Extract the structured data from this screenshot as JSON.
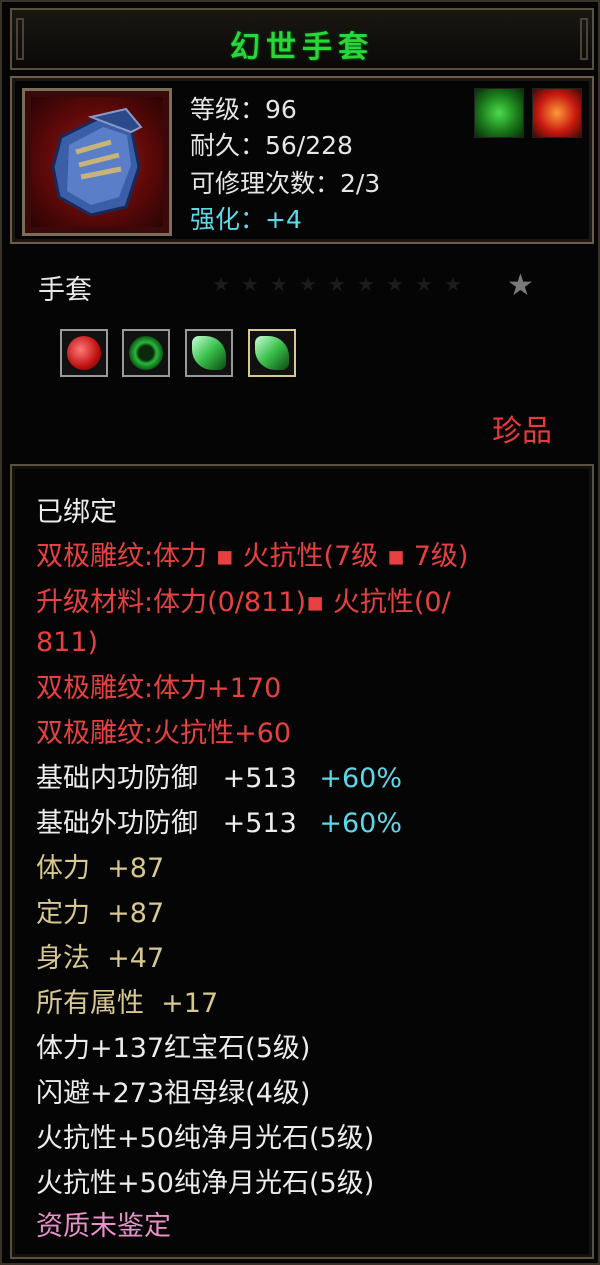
{
  "item": {
    "name": "幻世手套",
    "stats": {
      "level": "等级：96",
      "durability": "耐久：56/228",
      "repair_count": "可修理次数：2/3",
      "enhance": "强化：+4"
    },
    "type": "手套",
    "star_level": 0,
    "max_stars": 10,
    "rarity": "珍品",
    "icon": "blue-gauntlet-icon",
    "badges": [
      "green-rune-badge-icon",
      "red-rune-badge-icon"
    ],
    "gems": [
      {
        "icon": "ruby-gem-icon",
        "color": "#d01818"
      },
      {
        "icon": "emerald-ring-gem-icon",
        "color": "#2aa83a"
      },
      {
        "icon": "moonstone-gem-icon",
        "color": "#3ac04a"
      },
      {
        "icon": "moonstone-gem-icon",
        "color": "#3ac04a"
      }
    ]
  },
  "attributes": {
    "bound": "已绑定",
    "engrave_line": "双极雕纹:体力 ▪ 火抗性(7级 ▪ 7级)",
    "upgrade_line1": "升级材料:体力(0/811)▪ 火抗性(0/",
    "upgrade_line2": "811)",
    "engrave_vit": "双极雕纹:体力+170",
    "engrave_fire": "双极雕纹:火抗性+60",
    "inner_def_label": "基础内功防御",
    "inner_def_value": "+513",
    "inner_def_pct": "+60%",
    "outer_def_label": "基础外功防御",
    "outer_def_value": "+513",
    "outer_def_pct": "+60%",
    "vit": "体力  +87",
    "focus": "定力  +87",
    "agility": "身法  +47",
    "all_attr": "所有属性  +17",
    "gem1": "体力+137红宝石(5级)",
    "gem2": "闪避+273祖母绿(4级)",
    "gem3": "火抗性+50纯净月光石(5级)",
    "gem4": "火抗性+50纯净月光石(5级)",
    "quality": "资质未鉴定"
  },
  "colors": {
    "title": "#2bd63a",
    "red_text": "#e84040",
    "gold_text": "#d8c890",
    "cyan_text": "#5ed8e8",
    "pink_text": "#e890c8"
  }
}
